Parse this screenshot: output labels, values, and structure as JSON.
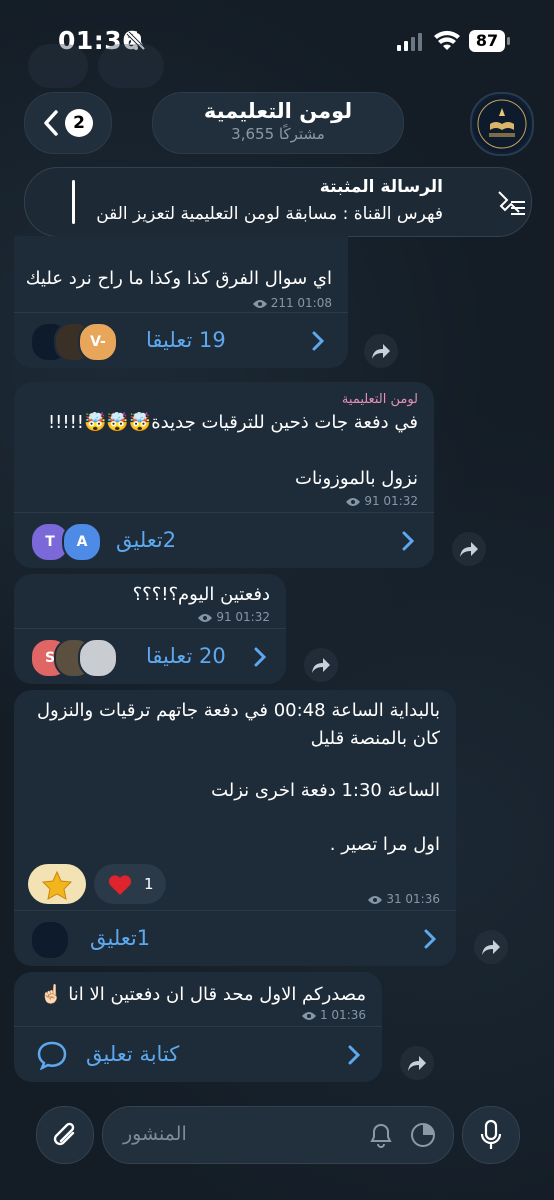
{
  "status": {
    "time": "01:36",
    "battery": "87"
  },
  "header": {
    "back_badge": "2",
    "title": "لومن التعليمية",
    "subtitle": "3,655 مشتركًا"
  },
  "pinned": {
    "title": "الرسالة المثبتة",
    "text": "فهرس القناة : مسابقة لومن التعليمية لتعزيز القن"
  },
  "messages": [
    {
      "lines": [
        "اي سوال الفرق كذا وكذا ما راح نرد عليك"
      ],
      "meta": "211 01:08",
      "comments": "19 تعليقا",
      "avatars": [
        "V-"
      ]
    },
    {
      "sender": "لومن التعليمية",
      "lines": [
        "في دفعة جات ذحين للترقيات جديدة🤯🤯🤯!!!!!",
        "نزول بالموزونات"
      ],
      "meta": "91 01:32",
      "comments": "2تعليق",
      "avatars": [
        "T",
        "A"
      ]
    },
    {
      "lines": [
        "دفعتين اليوم؟!؟؟؟"
      ],
      "meta": "91 01:32",
      "comments": "20 تعليقا",
      "avatars": [
        "S"
      ]
    },
    {
      "lines": [
        "بالبداية الساعة 00:48 في دفعة جاتهم ترقيات والنزول",
        "كان بالمنصة قليل",
        "الساعة 1:30 دفعة اخرى نزلت",
        "اول مرا تصير ."
      ],
      "heart_count": "1",
      "meta": "31 01:36",
      "comments": "1تعليق"
    },
    {
      "lines": [
        "مصدركم الاول محد قال ان دفعتين الا انا ☝🏻"
      ],
      "meta": "1 01:36",
      "comments": "كتابة تعليق"
    }
  ],
  "composer": {
    "placeholder": "المنشور"
  }
}
